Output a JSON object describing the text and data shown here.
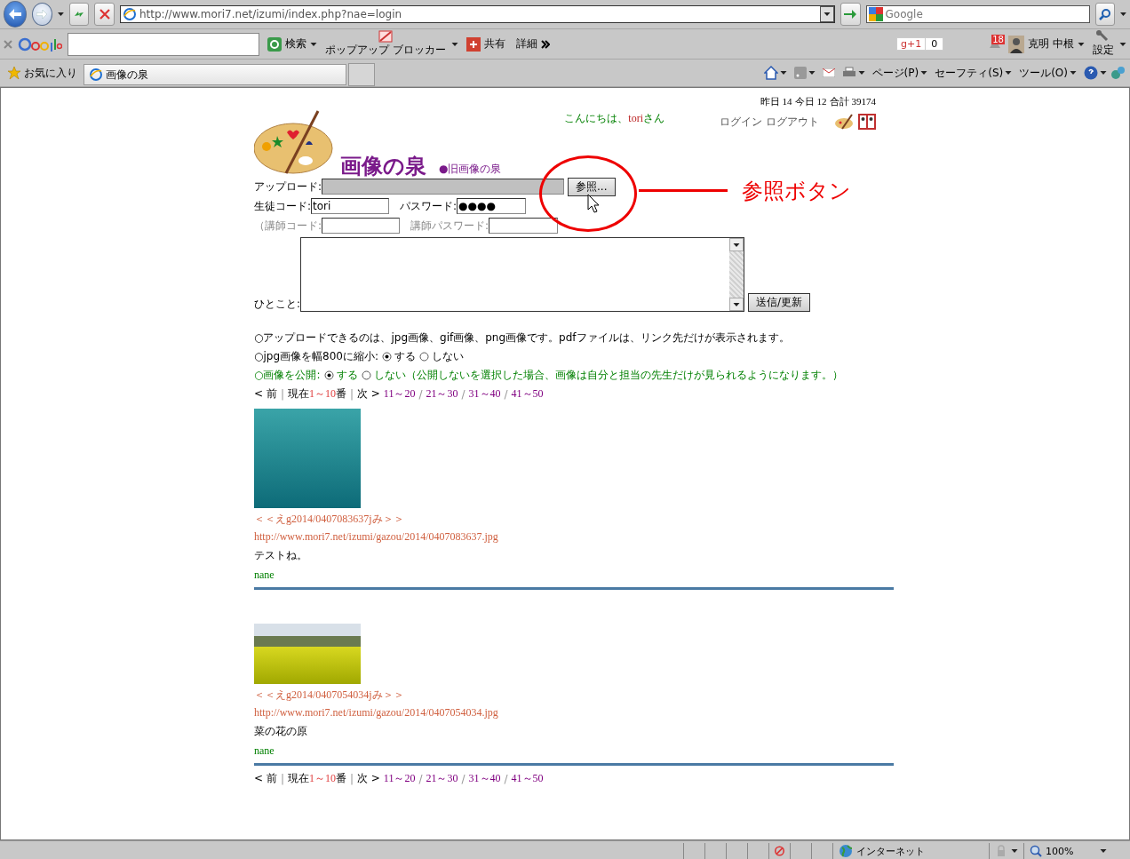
{
  "browser": {
    "address": "http://www.mori7.net/izumi/index.php?nae=login",
    "search_placeholder": "Google",
    "google_toolbar": {
      "search": "検索",
      "popup_blocker": "ポップアップ ブロッカー",
      "share": "共有",
      "more": "詳細",
      "plus_one_label": "g+1",
      "plus_one_count": "0",
      "notification_count": "18",
      "user": "克明 中根",
      "settings": "設定"
    },
    "favorites": "お気に入り",
    "tab_title": "画像の泉",
    "commands": [
      "ページ(P)",
      "セーフティ(S)",
      "ツール(O)"
    ]
  },
  "page": {
    "counter": [
      {
        "label": "昨日",
        "value": "14"
      },
      {
        "label": "今日",
        "value": "12"
      },
      {
        "label": "合計",
        "value": "39174"
      }
    ],
    "greeting": {
      "prefix": "こんにちは、",
      "user": "tori",
      "suffix": "さん"
    },
    "auth_links": [
      "ログイン",
      "ログアウト"
    ],
    "title": "画像の泉",
    "old_site_link": "●旧画像の泉",
    "form": {
      "upload_label": "アップロード:",
      "browse_button": "参照...",
      "student_code_label": "生徒コード:",
      "student_code": "tori",
      "password_label": "パスワード:",
      "password": "●●●●",
      "teacher_code_label": "（講師コード:",
      "teacher_password_label": "講師パスワード:",
      "comment_label": "ひとこと:",
      "submit_button": "送信/更新"
    },
    "notice": "○アップロードできるのは、jpg画像、gif画像、png画像です。pdfファイルは、リンク先だけが表示されます。",
    "option_groups": [
      {
        "label": "○jpg画像を幅800に縮小:",
        "kind": "plain",
        "options": [
          {
            "label": "する",
            "selected": true
          },
          {
            "label": "しない",
            "selected": false
          }
        ]
      },
      {
        "label": "○画像を公開:",
        "kind": "green",
        "options": [
          {
            "label": "する",
            "selected": true
          },
          {
            "label": "しない（公開しないを選択した場合、画像は自分と担当の先生だけが見られるようになります。）",
            "selected": false
          }
        ]
      }
    ],
    "pagers": [
      {
        "divider": "|",
        "page_divider": "/",
        "prev": "< 前",
        "current_label": "現在",
        "current": "1～10",
        "current_suffix": "番",
        "next": "次 >",
        "pages": [
          "11～20",
          "21～30",
          "31～40",
          "41～50"
        ]
      },
      {
        "divider": "|",
        "page_divider": "/",
        "prev": "< 前",
        "current_label": "現在",
        "current": "1～10",
        "current_suffix": "番",
        "next": "次 >",
        "pages": [
          "11～20",
          "21～30",
          "31～40",
          "41～50"
        ]
      }
    ],
    "posts": [
      {
        "kind": "dolphin",
        "title": "＜＜えg2014/0407083637jみ＞＞",
        "url": "http://www.mori7.net/izumi/gazou/2014/0407083637.jpg",
        "comment": "テストね。",
        "author": "nane"
      },
      {
        "kind": "field",
        "title": "＜＜えg2014/0407054034jみ＞＞",
        "url": "http://www.mori7.net/izumi/gazou/2014/0407054034.jpg",
        "comment": "菜の花の原",
        "author": "nane"
      }
    ],
    "callout": "参照ボタン"
  },
  "status_bar": {
    "zone": "インターネット",
    "zoom": "100%"
  }
}
